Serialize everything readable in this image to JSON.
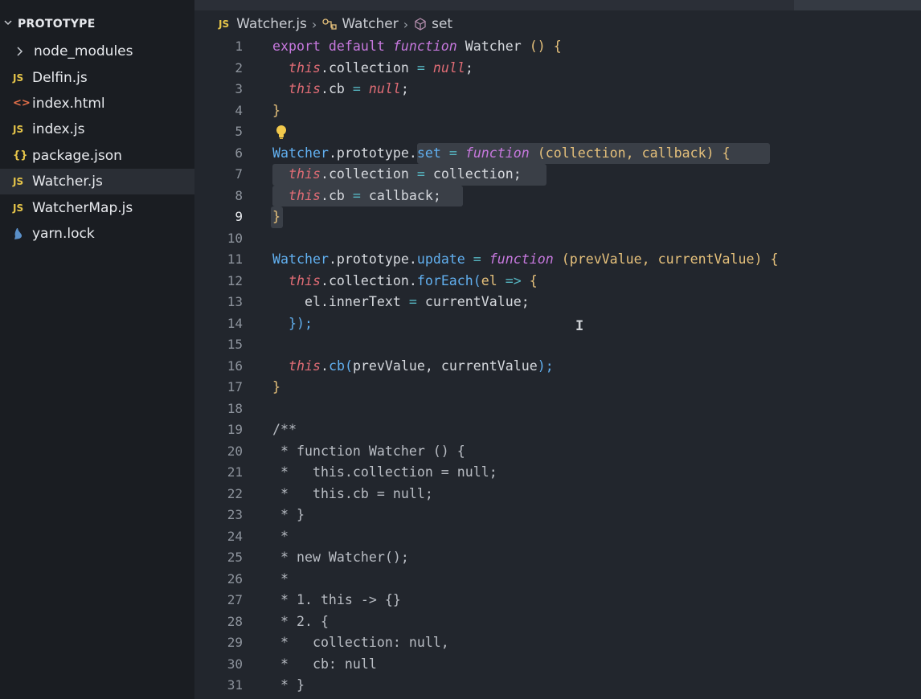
{
  "explorer": {
    "title": "PROTOTYPE",
    "items": [
      {
        "label": "node_modules",
        "icon": "folder-chevron-icon",
        "type": "folder"
      },
      {
        "label": "Delfin.js",
        "icon": "js-file-icon",
        "type": "js"
      },
      {
        "label": "index.html",
        "icon": "html-file-icon",
        "type": "html"
      },
      {
        "label": "index.js",
        "icon": "js-file-icon",
        "type": "js"
      },
      {
        "label": "package.json",
        "icon": "json-file-icon",
        "type": "json"
      },
      {
        "label": "Watcher.js",
        "icon": "js-file-icon",
        "type": "js",
        "selected": true
      },
      {
        "label": "WatcherMap.js",
        "icon": "js-file-icon",
        "type": "js"
      },
      {
        "label": "yarn.lock",
        "icon": "yarn-file-icon",
        "type": "yarn"
      }
    ]
  },
  "breadcrumb": {
    "file_badge": "JS",
    "file": "Watcher.js",
    "symbol": "Watcher",
    "member": "set"
  },
  "editor": {
    "active_line": 9,
    "lines": [
      {
        "n": "1"
      },
      {
        "n": "2"
      },
      {
        "n": "3"
      },
      {
        "n": "4"
      },
      {
        "n": "5"
      },
      {
        "n": "6"
      },
      {
        "n": "7"
      },
      {
        "n": "8"
      },
      {
        "n": "9"
      },
      {
        "n": "10"
      },
      {
        "n": "11"
      },
      {
        "n": "12"
      },
      {
        "n": "13"
      },
      {
        "n": "14"
      },
      {
        "n": "15"
      },
      {
        "n": "16"
      },
      {
        "n": "17"
      },
      {
        "n": "18"
      },
      {
        "n": "19"
      },
      {
        "n": "20"
      },
      {
        "n": "21"
      },
      {
        "n": "22"
      },
      {
        "n": "23"
      },
      {
        "n": "24"
      },
      {
        "n": "25"
      },
      {
        "n": "26"
      },
      {
        "n": "27"
      },
      {
        "n": "28"
      },
      {
        "n": "29"
      },
      {
        "n": "30"
      },
      {
        "n": "31"
      }
    ],
    "code": [
      [
        [
          "export default ",
          "k"
        ],
        [
          "function",
          "kw"
        ],
        [
          " ",
          "pl"
        ],
        [
          "Watcher",
          "pl"
        ],
        [
          " () {",
          "br"
        ]
      ],
      [
        [
          "  ",
          "pl"
        ],
        [
          "this",
          "th"
        ],
        [
          ".collection ",
          "pr"
        ],
        [
          "=",
          "op"
        ],
        [
          " ",
          "pl"
        ],
        [
          "null",
          "nl"
        ],
        [
          ";",
          "pl"
        ]
      ],
      [
        [
          "  ",
          "pl"
        ],
        [
          "this",
          "th"
        ],
        [
          ".cb ",
          "pr"
        ],
        [
          "=",
          "op"
        ],
        [
          " ",
          "pl"
        ],
        [
          "null",
          "nl"
        ],
        [
          ";",
          "pl"
        ]
      ],
      [
        [
          "}",
          "br"
        ]
      ],
      [],
      [
        [
          "Watcher",
          "cls"
        ],
        [
          ".prototype.",
          "pr"
        ],
        [
          "set",
          "fn"
        ],
        [
          " ",
          "pl"
        ],
        [
          "=",
          "op"
        ],
        [
          " ",
          "pl"
        ],
        [
          "function",
          "kw"
        ],
        [
          " (",
          "pa"
        ],
        [
          "collection, callback",
          "pa"
        ],
        [
          ") {",
          "br"
        ]
      ],
      [
        [
          "  ",
          "pl"
        ],
        [
          "this",
          "th"
        ],
        [
          ".collection ",
          "pr"
        ],
        [
          "=",
          "op"
        ],
        [
          " collection;",
          "pl"
        ]
      ],
      [
        [
          "  ",
          "pl"
        ],
        [
          "this",
          "th"
        ],
        [
          ".cb ",
          "pr"
        ],
        [
          "=",
          "op"
        ],
        [
          " callback;",
          "pl"
        ]
      ],
      [
        [
          "}",
          "br"
        ]
      ],
      [],
      [
        [
          "Watcher",
          "cls"
        ],
        [
          ".prototype.",
          "pr"
        ],
        [
          "update",
          "fn"
        ],
        [
          " ",
          "pl"
        ],
        [
          "=",
          "op"
        ],
        [
          " ",
          "pl"
        ],
        [
          "function",
          "kw"
        ],
        [
          " (",
          "pa"
        ],
        [
          "prevValue, currentValue",
          "pa"
        ],
        [
          ") {",
          "br"
        ]
      ],
      [
        [
          "  ",
          "pl"
        ],
        [
          "this",
          "th"
        ],
        [
          ".collection.",
          "pr"
        ],
        [
          "forEach",
          "fn"
        ],
        [
          "(",
          "fn"
        ],
        [
          "el ",
          "pa"
        ],
        [
          "=>",
          "op"
        ],
        [
          " {",
          "br"
        ]
      ],
      [
        [
          "    el.innerText ",
          "pl"
        ],
        [
          "=",
          "op"
        ],
        [
          " currentValue;",
          "pl"
        ]
      ],
      [
        [
          "  ",
          "pl"
        ],
        [
          "});",
          "fn"
        ]
      ],
      [],
      [
        [
          "  ",
          "pl"
        ],
        [
          "this",
          "th"
        ],
        [
          ".",
          "pr"
        ],
        [
          "cb",
          "fn"
        ],
        [
          "(",
          "fn"
        ],
        [
          "prevValue, currentValue",
          "pl"
        ],
        [
          ");",
          "fn"
        ]
      ],
      [
        [
          "}",
          "br"
        ]
      ],
      [],
      [
        [
          "/**",
          "cm"
        ]
      ],
      [
        [
          " * function Watcher () {",
          "cm"
        ]
      ],
      [
        [
          " *   this.collection = null;",
          "cm"
        ]
      ],
      [
        [
          " *   this.cb = null;",
          "cm"
        ]
      ],
      [
        [
          " * }",
          "cm"
        ]
      ],
      [
        [
          " *",
          "cm"
        ]
      ],
      [
        [
          " * new Watcher();",
          "cm"
        ]
      ],
      [
        [
          " *",
          "cm"
        ]
      ],
      [
        [
          " * 1. this -> {}",
          "cm"
        ]
      ],
      [
        [
          " * 2. {",
          "cm"
        ]
      ],
      [
        [
          " *   collection: null,",
          "cm"
        ]
      ],
      [
        [
          " *   cb: null",
          "cm"
        ]
      ],
      [
        [
          " * }",
          "cm"
        ]
      ]
    ]
  },
  "colors": {
    "sidebar_bg": "#1a1d22",
    "editor_bg": "#22262d",
    "selection": "#3a3f47",
    "keyword": "#c678dd",
    "this": "#e06c75",
    "function": "#61afef",
    "param": "#e5c07b"
  }
}
